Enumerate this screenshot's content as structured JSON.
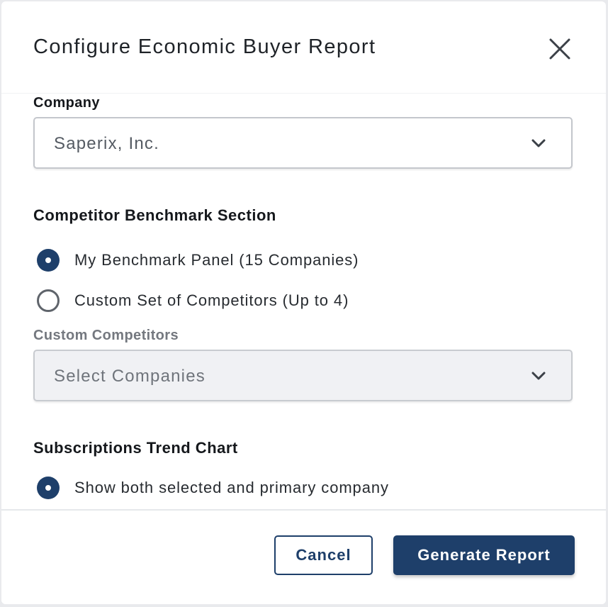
{
  "dialog": {
    "title": "Configure Economic Buyer Report",
    "close_icon": "close-icon"
  },
  "company": {
    "label": "Company",
    "selected": "Saperix, Inc.",
    "chevron_icon": "chevron-down-icon"
  },
  "competitor_section": {
    "title": "Competitor Benchmark Section",
    "options": [
      {
        "label": "My Benchmark Panel (15 Companies)",
        "checked": true
      },
      {
        "label": "Custom Set of Competitors (Up to 4)",
        "checked": false
      }
    ],
    "custom_label": "Custom Competitors",
    "custom_placeholder": "Select Companies"
  },
  "trend_chart": {
    "title": "Subscriptions Trend Chart",
    "options": [
      {
        "label": "Show both selected and primary company",
        "checked": true
      }
    ]
  },
  "footer": {
    "cancel_label": "Cancel",
    "generate_label": "Generate Report"
  },
  "colors": {
    "primary": "#1e3f6a",
    "text": "#15181c",
    "muted": "#74787f",
    "border": "#c4c7cc"
  }
}
